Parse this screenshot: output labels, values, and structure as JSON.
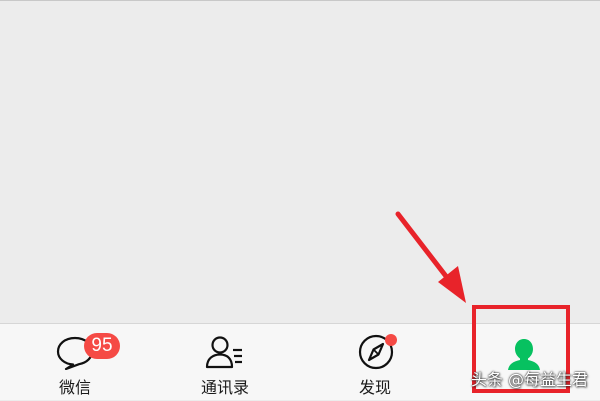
{
  "tabbar": {
    "tabs": [
      {
        "label": "微信",
        "icon": "chat-bubble-icon",
        "badge": "95"
      },
      {
        "label": "通讯录",
        "icon": "contacts-icon"
      },
      {
        "label": "发现",
        "icon": "compass-icon",
        "dot": true
      },
      {
        "label": "我",
        "icon": "person-icon",
        "active": true
      }
    ]
  },
  "colors": {
    "accent": "#07c160",
    "badge": "#f54a45",
    "annotation": "#e8232a",
    "tabbar_bg": "#f7f7f7",
    "content_bg": "#ececec"
  },
  "watermark": {
    "text": "头条 @每益生君"
  }
}
